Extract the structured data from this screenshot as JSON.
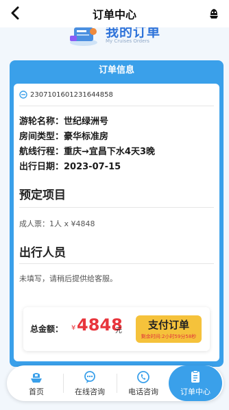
{
  "header": {
    "title": "订单中心"
  },
  "banner": {
    "title": "我的订单",
    "subtitle": "My Cruises Orders"
  },
  "card": {
    "heading": "订单信息",
    "order_number": "2307101601231644858",
    "ship": "游轮名称：世纪绿洲号",
    "room": "房间类型：豪华标准房",
    "route": "航线行程：重庆→宜昌下水4天3晚",
    "date": "出行日期：2023-07-15",
    "booking_title": "预定项目",
    "booking_item": "成人票：1人 x ¥4848",
    "travelers_title": "出行人员",
    "travelers_note": "未填写，请稍后提供给客服。"
  },
  "payment": {
    "total_label": "总金额：",
    "currency": "¥",
    "amount": "4848",
    "unit": "元",
    "pay_button": "支付订单",
    "remaining": "剩余时间:2小时59分58秒"
  },
  "tabs": [
    {
      "label": "首页",
      "icon": "ship-icon"
    },
    {
      "label": "在线咨询",
      "icon": "chat-icon"
    },
    {
      "label": "电话咨询",
      "icon": "phone-icon"
    },
    {
      "label": "订单中心",
      "icon": "order-icon",
      "active": true
    }
  ],
  "colors": {
    "accent": "#3aa0ea",
    "price": "#e8353c",
    "pay_button": "#f5c23b"
  }
}
